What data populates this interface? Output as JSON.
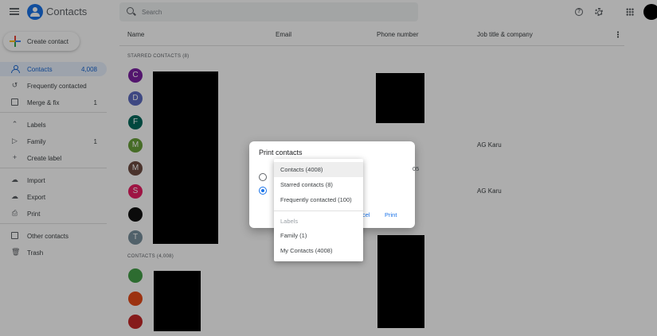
{
  "header": {
    "app_title": "Contacts",
    "search_placeholder": "Search"
  },
  "sidebar": {
    "create_label": "Create contact",
    "items": [
      {
        "label": "Contacts",
        "count": "4,008"
      },
      {
        "label": "Frequently contacted",
        "count": ""
      },
      {
        "label": "Merge & fix",
        "count": "1"
      },
      {
        "label": "Labels",
        "count": ""
      },
      {
        "label": "Family",
        "count": "1"
      },
      {
        "label": "Create label",
        "count": ""
      },
      {
        "label": "Import",
        "count": ""
      },
      {
        "label": "Export",
        "count": ""
      },
      {
        "label": "Print",
        "count": ""
      },
      {
        "label": "Other contacts",
        "count": ""
      },
      {
        "label": "Trash",
        "count": ""
      }
    ]
  },
  "table": {
    "columns": [
      "Name",
      "Email",
      "Phone number",
      "Job title & company"
    ],
    "starred_label": "STARRED CONTACTS (8)",
    "contacts_label": "CONTACTS (4,008)",
    "starred_rows": [
      {
        "initial": "C",
        "color": "#7b1fa2",
        "job": ""
      },
      {
        "initial": "D",
        "color": "#5c6bc0",
        "job": ""
      },
      {
        "initial": "F",
        "color": "#00695c",
        "job": ""
      },
      {
        "initial": "M",
        "color": "#689f38",
        "job": "AG Karu"
      },
      {
        "initial": "M",
        "color": "#6d4c41",
        "job": ""
      },
      {
        "initial": "S",
        "color": "#e91e63",
        "job": "AG Karu"
      },
      {
        "initial": "",
        "color": "#111111",
        "job": ""
      },
      {
        "initial": "T",
        "color": "#78909c",
        "job": ""
      }
    ],
    "contact_rows": [
      {
        "initial": "",
        "color": "#43a047"
      },
      {
        "initial": "",
        "color": "#e64a19"
      },
      {
        "initial": "",
        "color": "#c62828"
      }
    ]
  },
  "dialog": {
    "title": "Print contacts",
    "cancel_partial": "cel",
    "print_label": "Print",
    "peek_phone": "05"
  },
  "dropdown": {
    "options": [
      "Contacts (4008)",
      "Starred contacts (8)",
      "Frequently contacted (100)"
    ],
    "labels_header": "Labels",
    "label_options": [
      "Family (1)",
      "My Contacts (4008)"
    ]
  }
}
